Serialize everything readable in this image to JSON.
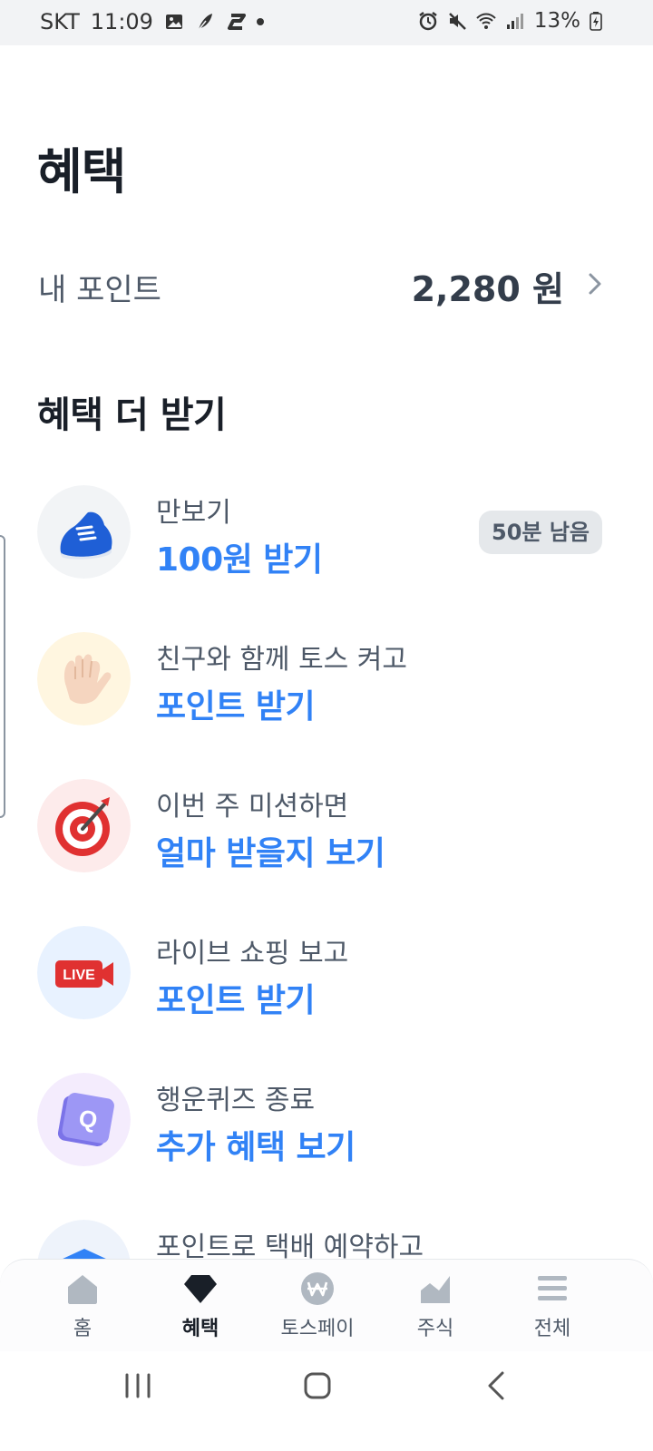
{
  "status_bar": {
    "carrier": "SKT",
    "time": "11:09",
    "battery": "13%",
    "left_icons": [
      "gallery-icon",
      "feather-icon",
      "s-app-icon"
    ],
    "right_icons": [
      "alarm-icon",
      "mute-icon",
      "wifi-icon",
      "signal-icon",
      "battery-icon"
    ]
  },
  "page": {
    "title": "혜택"
  },
  "points": {
    "label": "내 포인트",
    "value": "2,280 원"
  },
  "section": {
    "title": "혜택 더 받기"
  },
  "benefits": [
    {
      "icon": "sneaker-icon",
      "subtitle": "만보기",
      "action": "100원 받기",
      "badge": "50분 남음"
    },
    {
      "icon": "waving-hand-icon",
      "subtitle": "친구와 함께 토스 켜고",
      "action": "포인트 받기"
    },
    {
      "icon": "target-dart-icon",
      "subtitle": "이번 주 미션하면",
      "action": "얼마 받을지 보기"
    },
    {
      "icon": "live-camera-icon",
      "subtitle": "라이브 쇼핑 보고",
      "action": "포인트 받기",
      "icon_text": "LIVE"
    },
    {
      "icon": "quiz-cube-icon",
      "subtitle": "행운퀴즈 종료",
      "action": "추가 혜택 보기",
      "icon_text": "Q"
    },
    {
      "icon": "delivery-box-icon",
      "subtitle": "포인트로 택배 예약하고",
      "action": ""
    }
  ],
  "tabbar": {
    "tabs": [
      {
        "label": "홈",
        "icon": "home-icon"
      },
      {
        "label": "혜택",
        "icon": "benefit-gem-icon",
        "active": true
      },
      {
        "label": "토스페이",
        "icon": "won-coin-icon"
      },
      {
        "label": "주식",
        "icon": "stock-chart-icon"
      },
      {
        "label": "전체",
        "icon": "menu-icon"
      }
    ]
  },
  "colors": {
    "accent": "#3182f6",
    "text_primary": "#191f28",
    "text_secondary": "#4e5968",
    "badge_bg": "#e5e8eb",
    "statusbar_bg": "#f2f3f5"
  }
}
